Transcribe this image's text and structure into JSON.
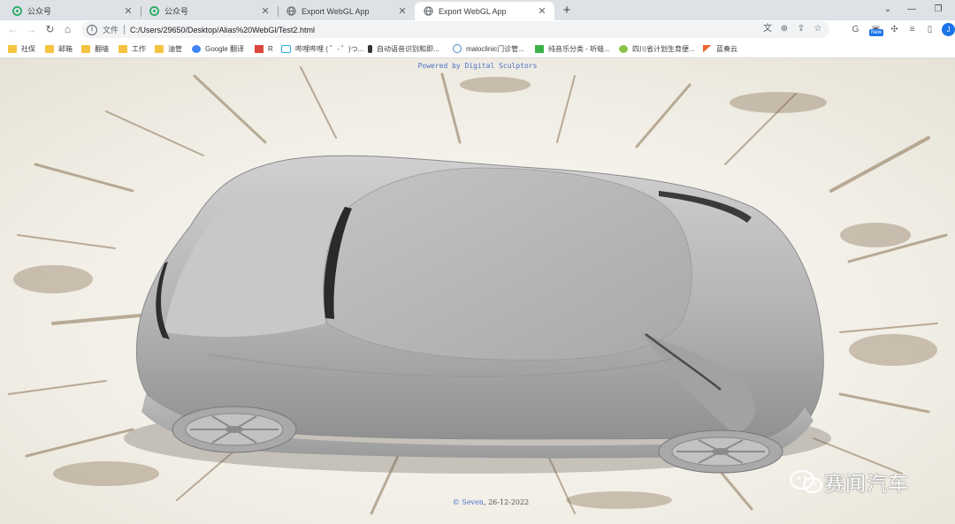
{
  "tabs": [
    {
      "title": "公众号",
      "icon": "wechat-mp-icon",
      "active": false
    },
    {
      "title": "公众号",
      "icon": "wechat-mp-icon",
      "active": false
    },
    {
      "title": "Export WebGL App",
      "icon": "globe-icon",
      "active": false
    },
    {
      "title": "Export WebGL App",
      "icon": "globe-icon",
      "active": true
    }
  ],
  "toolbar": {
    "scheme_label": "文件",
    "url": "C:/Users/29650/Desktop/Alias%20WebGl/Test2.html",
    "ext_new_badge": "New",
    "profile_initial": "J"
  },
  "bookmarks": [
    {
      "label": "社保",
      "icon": "folder-icon"
    },
    {
      "label": "邮箱",
      "icon": "folder-icon"
    },
    {
      "label": "翻墙",
      "icon": "folder-icon"
    },
    {
      "label": "工作",
      "icon": "folder-icon"
    },
    {
      "label": "油管",
      "icon": "folder-icon"
    },
    {
      "label": "Google 翻译",
      "icon": "google-translate-icon"
    },
    {
      "label": "R",
      "icon": "r-site-icon"
    },
    {
      "label": "哔哩哔哩 ( ゜- ゜)つ...",
      "icon": "bilibili-icon"
    },
    {
      "label": "自动语音识别和即...",
      "icon": "microphone-icon"
    },
    {
      "label": "maloclinic门诊管...",
      "icon": "clinic-icon"
    },
    {
      "label": "纯音乐分类 - 听蛙...",
      "icon": "music-icon"
    },
    {
      "label": "四川省计划生育便...",
      "icon": "sichuan-icon"
    },
    {
      "label": "蓝奏云",
      "icon": "lanzou-icon"
    }
  ],
  "viewer": {
    "powered_text": "Powered by Digital Sculptors",
    "footer_author": "© Seven",
    "footer_date": "26-12-2022"
  },
  "watermark": {
    "text": "赛闻汽车",
    "icon": "wechat-icon"
  },
  "colors": {
    "tab_strip": "#dee1e6",
    "link_blue": "#4a72c9",
    "car_body": "#b4b4b4"
  }
}
